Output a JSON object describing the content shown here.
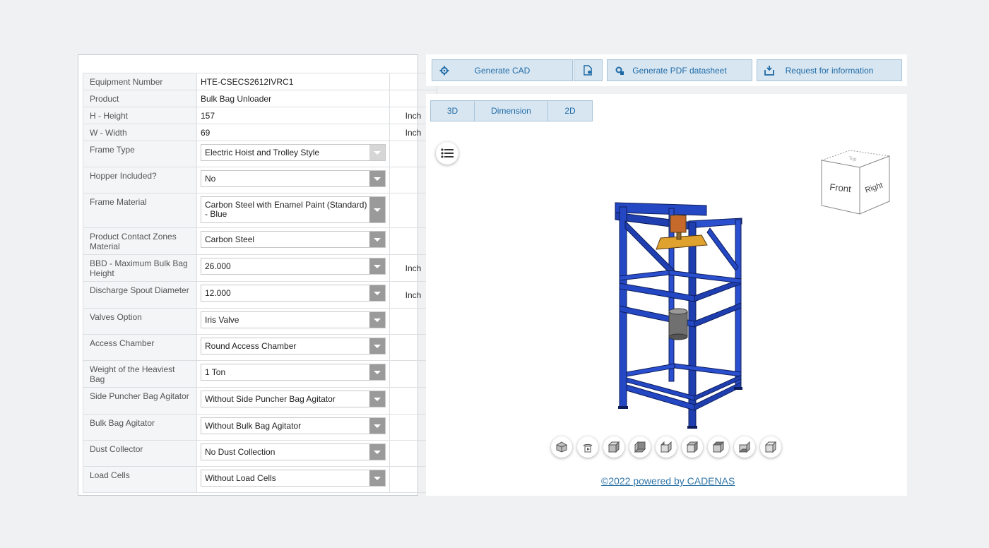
{
  "properties": [
    {
      "label": "Equipment Number",
      "value": "HTE-CSECS2612IVRC1",
      "type": "text",
      "unit": ""
    },
    {
      "label": "Product",
      "value": "Bulk Bag Unloader",
      "type": "text",
      "unit": ""
    },
    {
      "label": "H - Height",
      "value": "157",
      "type": "text",
      "unit": "Inch"
    },
    {
      "label": "W - Width",
      "value": "69",
      "type": "text",
      "unit": "Inch"
    },
    {
      "label": "Frame Type",
      "value": "Electric Hoist and Trolley Style",
      "type": "select",
      "unit": "",
      "disabled": true
    },
    {
      "label": "Hopper Included?",
      "value": "No",
      "type": "select",
      "unit": ""
    },
    {
      "label": "Frame Material",
      "value": "Carbon Steel with Enamel Paint (Standard) - Blue",
      "type": "select",
      "unit": "",
      "tall": true
    },
    {
      "label": "Product Contact Zones Material",
      "value": "Carbon Steel",
      "type": "select",
      "unit": ""
    },
    {
      "label": "BBD - Maximum Bulk Bag Height",
      "value": "26.000",
      "type": "select",
      "unit": "Inch"
    },
    {
      "label": "Discharge Spout Diameter",
      "value": "12.000",
      "type": "select",
      "unit": "Inch"
    },
    {
      "label": "Valves Option",
      "value": "Iris Valve",
      "type": "select",
      "unit": ""
    },
    {
      "label": "Access Chamber",
      "value": "Round Access Chamber",
      "type": "select",
      "unit": ""
    },
    {
      "label": "Weight of the Heaviest Bag",
      "value": "1 Ton",
      "type": "select",
      "unit": ""
    },
    {
      "label": "Side Puncher Bag Agitator",
      "value": "Without Side Puncher Bag Agitator",
      "type": "select",
      "unit": ""
    },
    {
      "label": "Bulk Bag Agitator",
      "value": "Without Bulk Bag Agitator",
      "type": "select",
      "unit": ""
    },
    {
      "label": "Dust Collector",
      "value": "No Dust Collection",
      "type": "select",
      "unit": ""
    },
    {
      "label": "Load Cells",
      "value": "Without Load Cells",
      "type": "select",
      "unit": ""
    }
  ],
  "toolbar": {
    "generate_cad": "Generate CAD",
    "generate_pdf": "Generate PDF datasheet",
    "request_info": "Request for information"
  },
  "viewer": {
    "tabs": [
      "3D",
      "Dimension",
      "2D"
    ],
    "cube_front": "Front",
    "cube_right": "Right",
    "cube_top": "Top",
    "footer": "©2022 powered by CADENAS"
  },
  "colors": {
    "frame_blue": "#1f3fb0",
    "accent": "#1e6aa6",
    "tab_bg": "#d8e6f1"
  }
}
